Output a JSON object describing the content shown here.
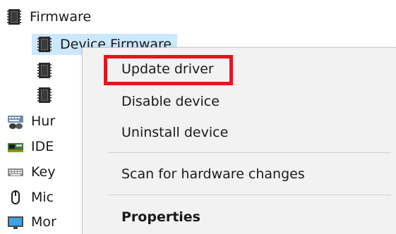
{
  "tree": {
    "firmware_category": {
      "label": "Firmware",
      "icon": "firmware-chip-icon"
    },
    "device_firmware": {
      "label": "Device Firmware",
      "icon": "firmware-chip-icon",
      "selected": true
    },
    "hidden_child_1": {
      "icon": "firmware-chip-icon"
    },
    "hidden_child_2": {
      "icon": "firmware-chip-icon"
    },
    "categories": [
      {
        "label": "Hur",
        "icon": "human-interface-devices-icon"
      },
      {
        "label": "IDE",
        "icon": "ide-controller-icon"
      },
      {
        "label": "Key",
        "icon": "keyboard-icon"
      },
      {
        "label": "Mic",
        "icon": "mouse-icon"
      },
      {
        "label": "Mor",
        "icon": "monitor-icon"
      }
    ]
  },
  "context_menu": {
    "update_driver": "Update driver",
    "disable_device": "Disable device",
    "uninstall_device": "Uninstall device",
    "scan_hardware": "Scan for hardware changes",
    "properties": "Properties"
  },
  "colors": {
    "selection": "#cce8ff",
    "menu_background": "#f2f2f2",
    "highlight_border": "#e8131e"
  }
}
